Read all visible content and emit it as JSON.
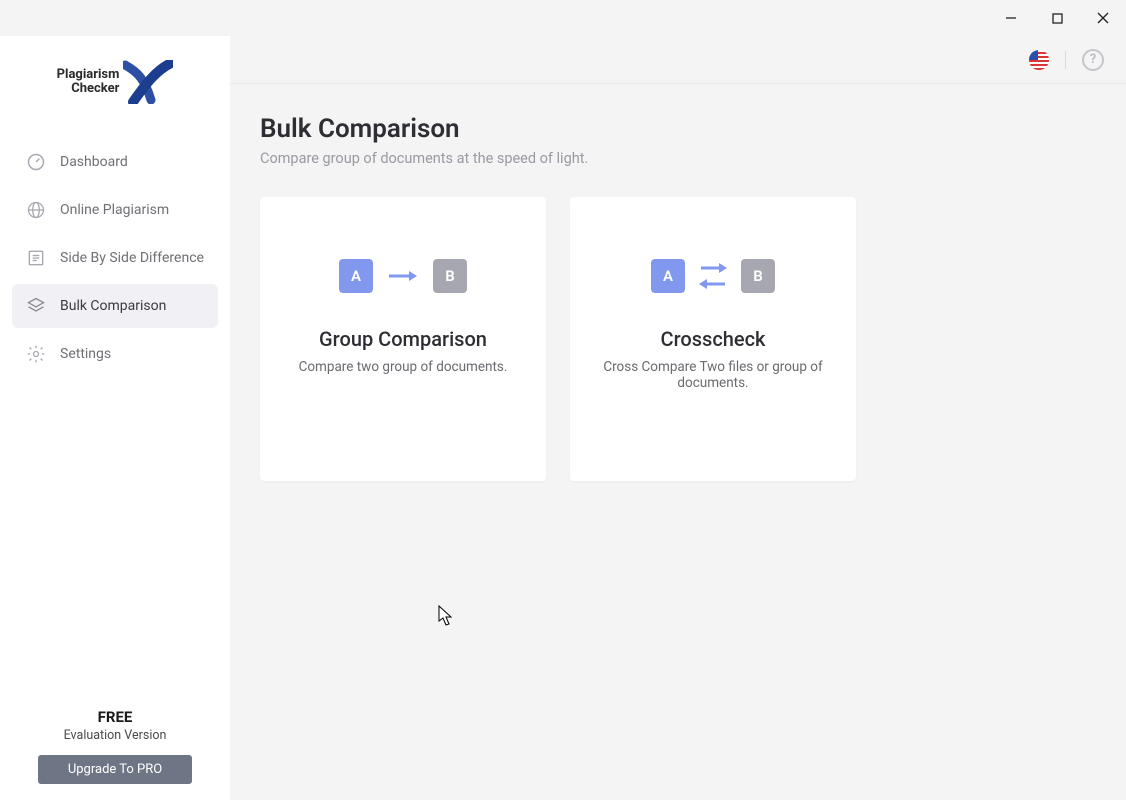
{
  "logo": {
    "line1": "Plagiarism",
    "line2": "Checker"
  },
  "sidebar": {
    "items": [
      {
        "label": "Dashboard"
      },
      {
        "label": "Online Plagiarism"
      },
      {
        "label": "Side By Side Difference"
      },
      {
        "label": "Bulk Comparison"
      },
      {
        "label": "Settings"
      }
    ],
    "free_label": "FREE",
    "eval_label": "Evaluation Version",
    "upgrade_label": "Upgrade To PRO"
  },
  "page": {
    "title": "Bulk Comparison",
    "subtitle": "Compare group of documents at the speed of light."
  },
  "cards": [
    {
      "title": "Group Comparison",
      "desc": "Compare two group of documents."
    },
    {
      "title": "Crosscheck",
      "desc": "Cross Compare Two files or group of documents."
    }
  ]
}
